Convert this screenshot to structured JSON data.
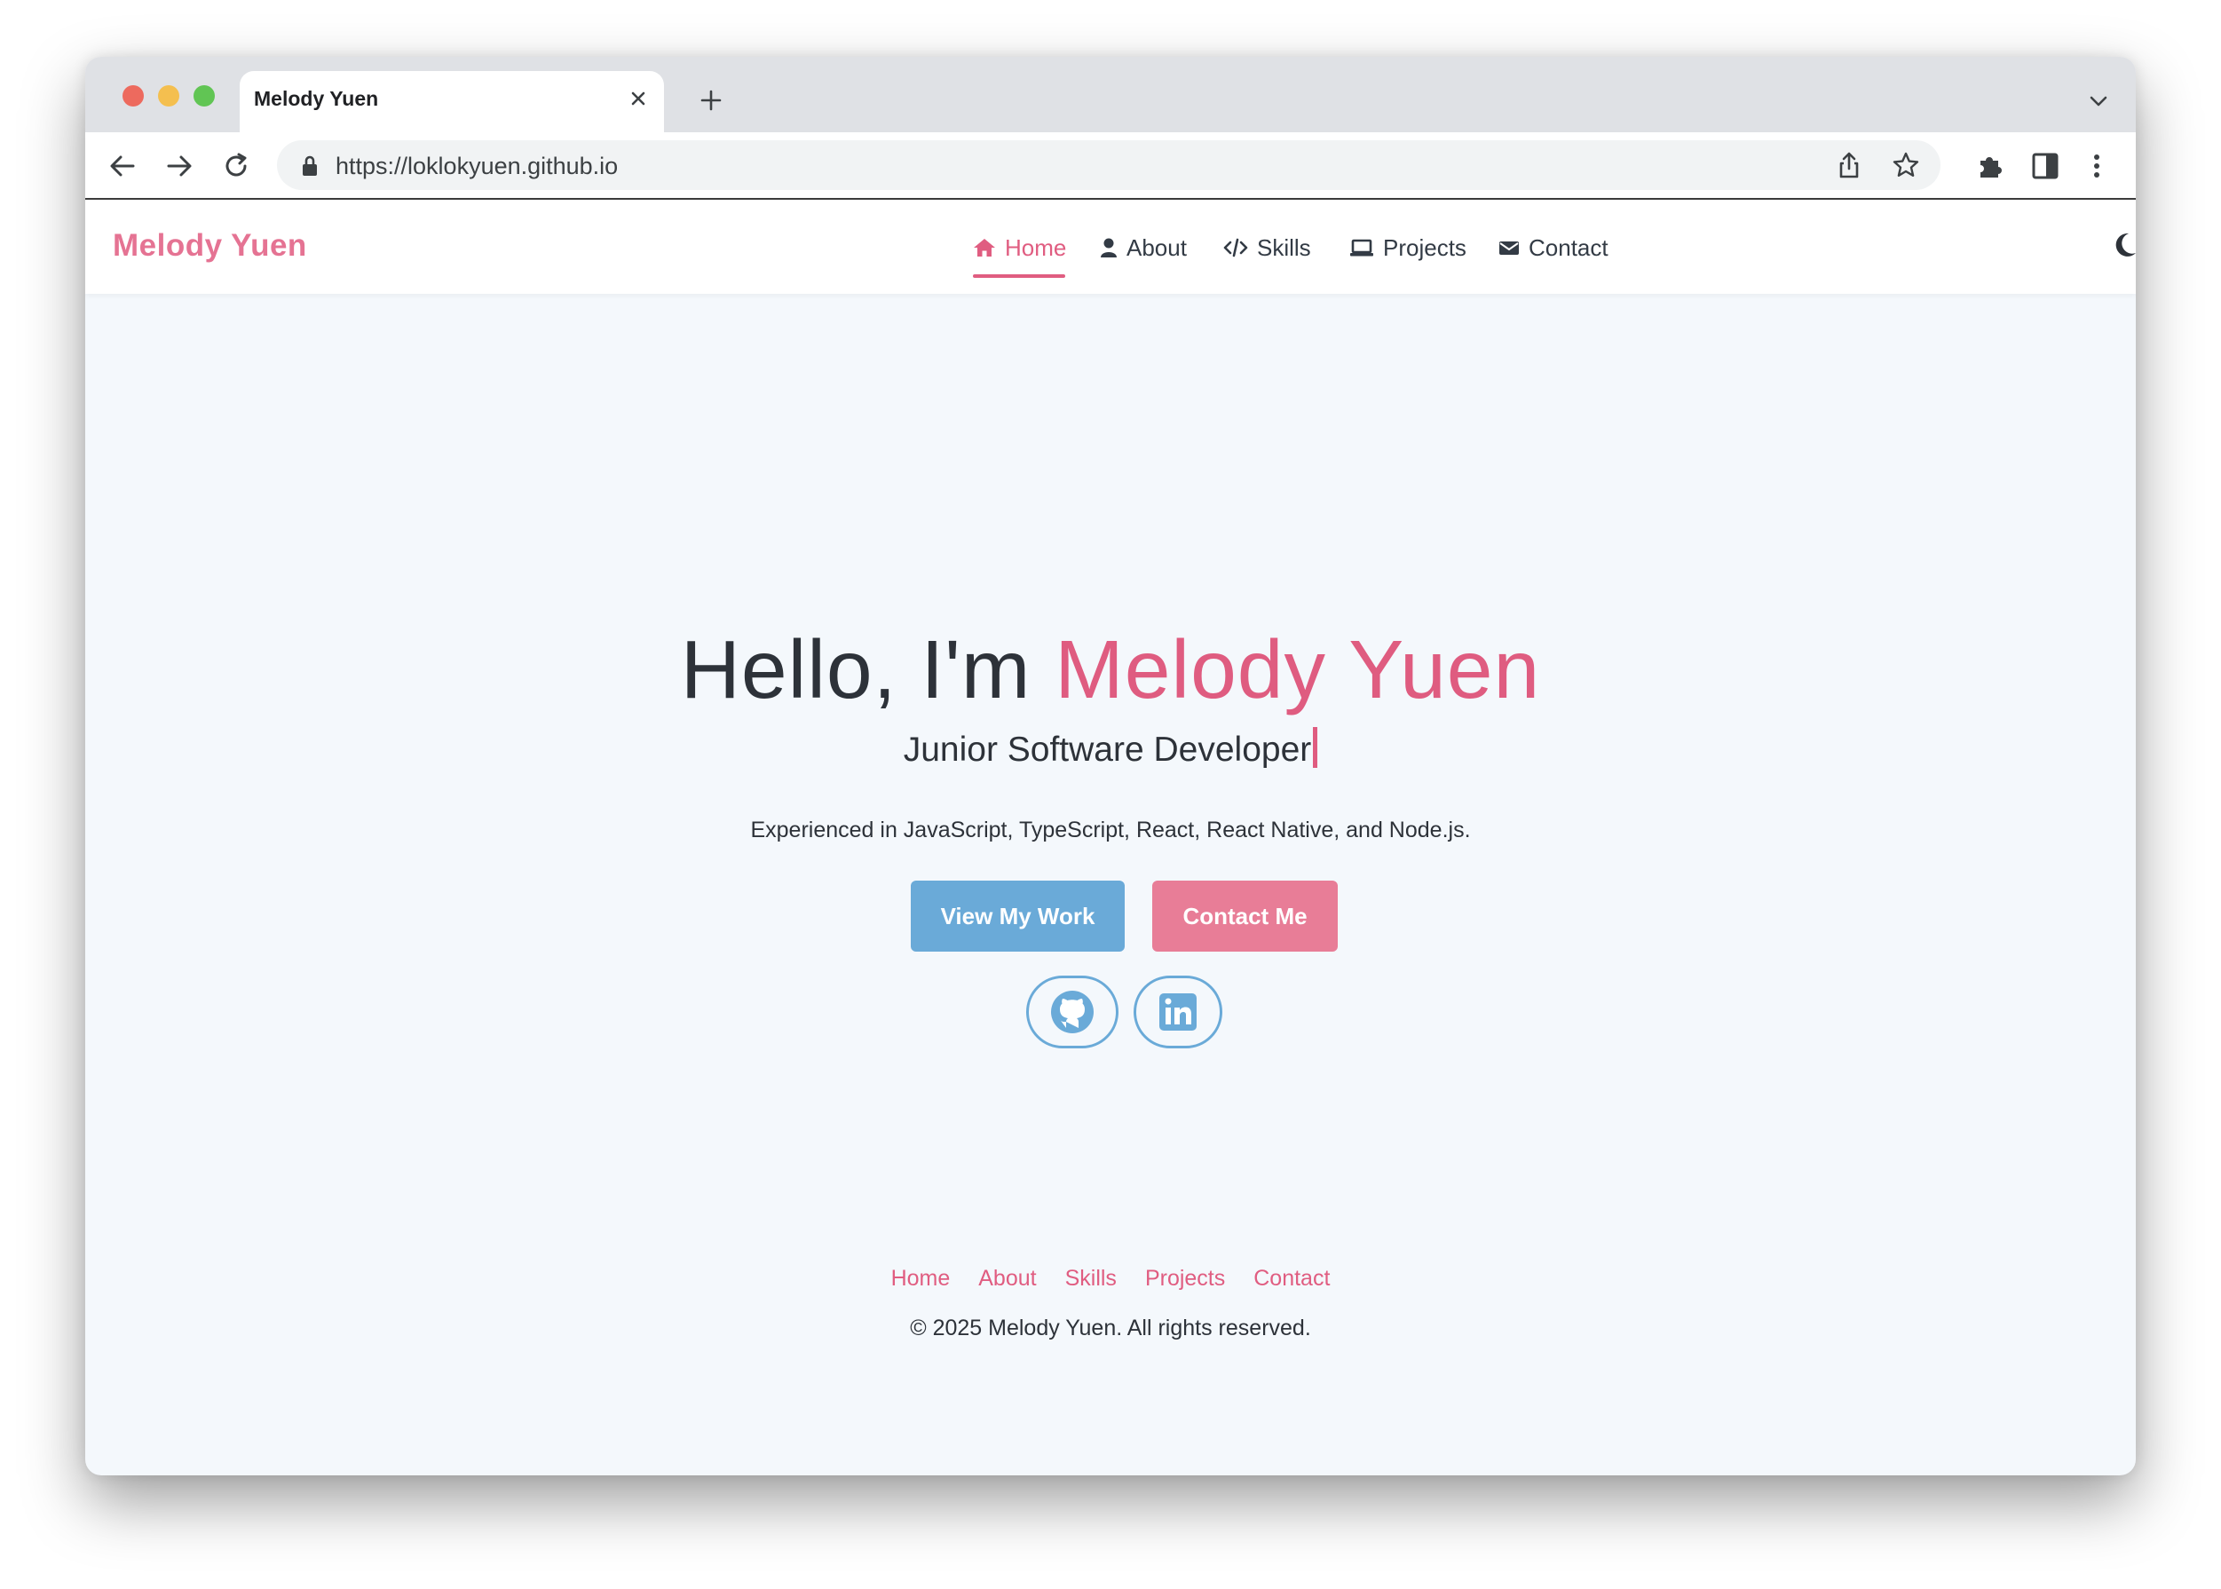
{
  "browser": {
    "tab_title": "Melody Yuen",
    "url": "https://loklokyuen.github.io"
  },
  "nav": {
    "brand": "Melody Yuen",
    "items": [
      {
        "label": "Home",
        "icon": "home-icon",
        "active": true
      },
      {
        "label": "About",
        "icon": "user-icon"
      },
      {
        "label": "Skills",
        "icon": "code-icon"
      },
      {
        "label": "Projects",
        "icon": "laptop-icon"
      },
      {
        "label": "Contact",
        "icon": "envelope-icon"
      }
    ],
    "theme_toggle_icon": "moon-icon"
  },
  "hero": {
    "greeting": "Hello, I'm",
    "name": "Melody Yuen",
    "subtitle": "Junior Software Developer",
    "description": "Experienced in JavaScript, TypeScript, React, React Native, and Node.js.",
    "primary_button": "View My Work",
    "secondary_button": "Contact Me",
    "social_icons": [
      "github-icon",
      "linkedin-icon"
    ]
  },
  "footer": {
    "links": [
      "Home",
      "About",
      "Skills",
      "Projects",
      "Contact"
    ],
    "copyright": "© 2025 Melody Yuen. All rights reserved."
  },
  "colors": {
    "accent_pink": "#df5c80",
    "accent_blue": "#6aaad8",
    "button_pink": "#e87d97",
    "page_background": "#f4f8fc"
  }
}
